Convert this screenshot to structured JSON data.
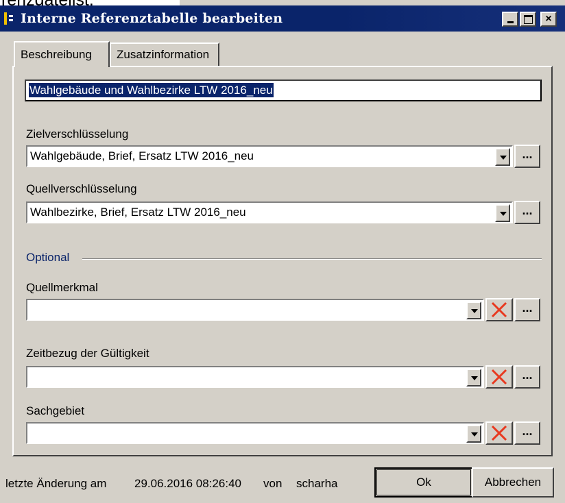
{
  "cropped_caption": "rerizdateiist.",
  "window": {
    "title": "Interne Referenztabelle bearbeiten",
    "min_label": "minimize",
    "max_label": "maximize",
    "close_glyph": "×"
  },
  "tabs": [
    {
      "label": "Beschreibung",
      "active": true
    },
    {
      "label": "Zusatzinformation",
      "active": false
    }
  ],
  "name_field": {
    "value": "Wahlgebäude und Wahlbezirke LTW 2016_neu"
  },
  "ziel": {
    "label": "Zielverschlüsselung",
    "value": "Wahlgebäude, Brief, Ersatz LTW 2016_neu"
  },
  "quell": {
    "label": "Quellverschlüsselung",
    "value": "Wahlbezirke, Brief, Ersatz LTW 2016_neu"
  },
  "optional_group": {
    "label": "Optional"
  },
  "quellmerkmal": {
    "label": "Quellmerkmal",
    "value": ""
  },
  "zeitbezug": {
    "label": "Zeitbezug der Gültigkeit",
    "value": ""
  },
  "sachgebiet": {
    "label": "Sachgebiet",
    "value": ""
  },
  "browse_label": "...",
  "status": {
    "prefix": "letzte Änderung am",
    "datetime": "29.06.2016 08:26:40",
    "by": "von",
    "user": "scharha"
  },
  "buttons": {
    "ok": "Ok",
    "cancel": "Abbrechen"
  },
  "colors": {
    "titlebar": "#0a246a",
    "clear_x": "#e8391f",
    "face": "#d4d0c8"
  },
  "icons": {
    "clear": "red-x-icon",
    "dropdown": "triangle-down-icon"
  }
}
